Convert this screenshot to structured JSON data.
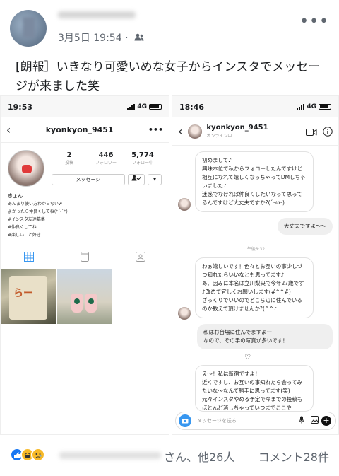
{
  "post": {
    "date": "3月5日 19:54",
    "privacy_sep": "·",
    "more_label": "•••",
    "text": "[朗報］いきなり可愛いめな女子からインスタでメッセージが来ました笑"
  },
  "left_phone": {
    "time": "19:53",
    "network": "4G",
    "username": "kyonkyon_9451",
    "more": "•••",
    "stats": [
      {
        "num": "2",
        "label": "投稿"
      },
      {
        "num": "446",
        "label": "フォロワー"
      },
      {
        "num": "5,774",
        "label": "フォロー中"
      }
    ],
    "message_button": "メッセージ",
    "bio_name": "きょん",
    "bio_lines": [
      "あんまり使い方わからないw",
      "よかったら仲良くしてね(*´-`*)",
      "#インスタ友達募集",
      "#仲良くしてね",
      "#楽しいこと好き"
    ],
    "tile1_text": "らー"
  },
  "right_phone": {
    "time": "18:46",
    "network": "4G",
    "username": "kyonkyon_9451",
    "status": "オンライン中",
    "messages": [
      {
        "text": "初めまして♪\n興味本位で私からフォローしたんですけど相互になれて嬉しくなっちゃってDMしちゃいました♪\n迷惑でなければ仲良くしたいなって思ってるんですけど大丈夫ですか?(´･ω･)"
      },
      {
        "text": "大丈夫ですよ〜〜"
      },
      {
        "text": "わぁ嬉しいです！色々とお互いの事少しづつ知れたらいいなとも思ってます♪\nあ、因みに本名は立川梨央で今年27歳です♪改めて宜しくお願いします(#^^#)\nざっくりでいいのでどこら辺に住んでいるのか教えて頂けませんか?(^^♪"
      },
      {
        "text": "私はお台場に住んでますよー\nなので、その手の写真が多いです！"
      },
      {
        "text": "え〜！私は新宿ですよ！\n近くですし、お互いの事知れたら会ってみたいな〜なんて勝手に思ってます(笑)\n元々インスタやめる予定で今までの投稿もほとんど消しちゃっていつまでここや"
      }
    ],
    "timestamp": "午後8:32",
    "reaction": "♡",
    "composer_placeholder": "メッセージを送る..."
  },
  "footer": {
    "reactors_text": "さん、他26人",
    "comments_text": "コメント28件"
  },
  "colors": {
    "facebook_blue": "#1877f2",
    "instagram_blue": "#3897f0"
  }
}
